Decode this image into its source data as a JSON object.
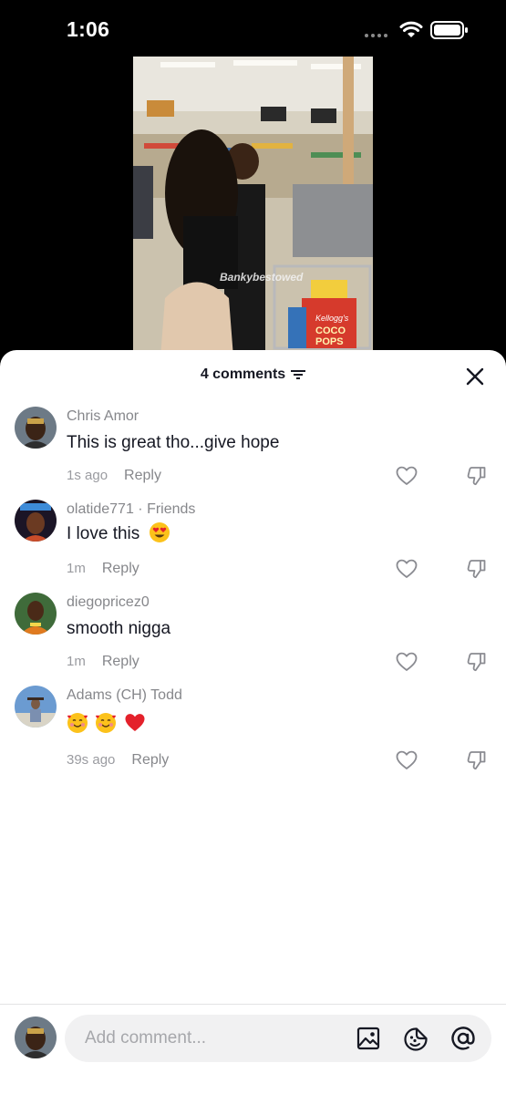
{
  "status_bar": {
    "time": "1:06"
  },
  "video": {
    "watermark": "Bankybestowed",
    "box_brand": "Kellogg's",
    "box_label_1": "COCO",
    "box_label_2": "POPS"
  },
  "comments_panel": {
    "count_label": "4 comments",
    "icons": {
      "filter": "filter-icon",
      "close": "close-icon"
    }
  },
  "comments": [
    {
      "name": "Chris Amor",
      "text": "This is great tho...give hope",
      "time": "1s ago",
      "reply": "Reply"
    },
    {
      "name": "olatide771 · Friends",
      "text": "I love this",
      "emoji": "heart-eyes-emoji",
      "time": "1m",
      "reply": "Reply"
    },
    {
      "name": "diegopricez0",
      "text": "smooth nigga",
      "time": "1m",
      "reply": "Reply"
    },
    {
      "name": "Adams (CH) Todd",
      "emoji": [
        "smiling-face-with-hearts-emoji",
        "smiling-face-with-hearts-emoji",
        "red-heart-emoji"
      ],
      "time": "39s ago",
      "reply": "Reply"
    }
  ],
  "composer": {
    "placeholder": "Add comment...",
    "icons": [
      "image-icon",
      "sticker-icon",
      "mention-icon"
    ]
  },
  "colors": {
    "text_primary": "#161823",
    "text_secondary": "#86878b",
    "input_bg": "#f1f1f2",
    "heart_red": "#e4212b"
  }
}
